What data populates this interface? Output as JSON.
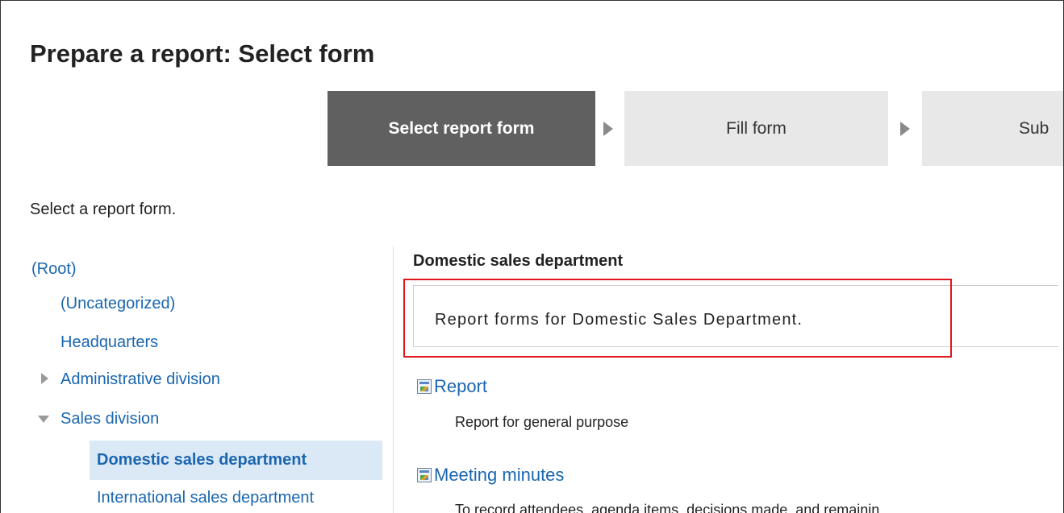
{
  "page": {
    "title": "Prepare a report: Select form",
    "instruction": "Select a report form."
  },
  "steps": [
    {
      "label": "Select report form",
      "active": true
    },
    {
      "label": "Fill form",
      "active": false
    },
    {
      "label": "Sub",
      "active": false
    }
  ],
  "tree": {
    "items": [
      {
        "label": "(Root)"
      },
      {
        "label": "(Uncategorized)"
      },
      {
        "label": "Headquarters"
      },
      {
        "label": "Administrative division",
        "toggle": "collapsed"
      },
      {
        "label": "Sales division",
        "toggle": "expanded"
      },
      {
        "label": "Domestic sales department",
        "selected": true
      },
      {
        "label": "International sales department"
      }
    ]
  },
  "category": {
    "heading": "Domestic sales department",
    "description": "Report forms for Domestic Sales Department."
  },
  "forms": [
    {
      "name": "Report",
      "description": "Report for general purpose",
      "icon": "report-form-icon"
    },
    {
      "name": "Meeting minutes",
      "description": "To record attendees, agenda items, decisions made, and remainin",
      "icon": "report-form-icon"
    }
  ],
  "colors": {
    "active_step": "#606060",
    "inactive_step": "#e8e8e8",
    "link": "#1a66b0",
    "selected_bg": "#dbe9f7",
    "highlight": "#e0161b"
  }
}
